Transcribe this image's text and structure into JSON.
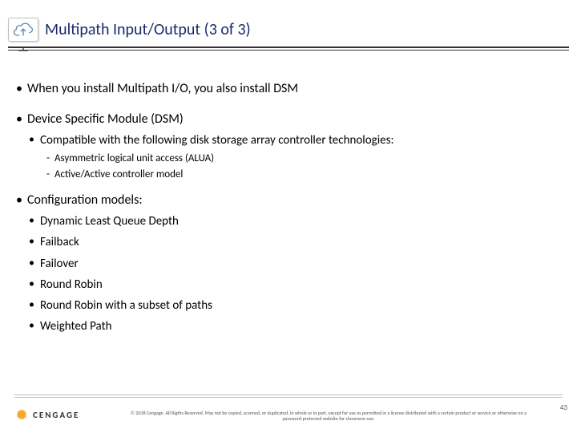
{
  "header": {
    "title": "Multipath Input/Output (3 of 3)",
    "icon": "cloud-icon"
  },
  "body": {
    "items": [
      {
        "level": 1,
        "text": "When you install Multipath I/O, you also install DSM"
      },
      {
        "level": 1,
        "text": "Device Specific Module (DSM)"
      },
      {
        "level": 2,
        "text": "Compatible with the following disk storage array controller technologies:"
      },
      {
        "level": 3,
        "text": "Asymmetric logical unit access (ALUA)"
      },
      {
        "level": 3,
        "text": "Active/Active controller model"
      },
      {
        "level": 1,
        "text": "Configuration models:"
      },
      {
        "level": 2,
        "text": "Dynamic Least Queue Depth"
      },
      {
        "level": 2,
        "text": "Failback"
      },
      {
        "level": 2,
        "text": "Failover"
      },
      {
        "level": 2,
        "text": "Round Robin"
      },
      {
        "level": 2,
        "text": "Round Robin with a subset of paths"
      },
      {
        "level": 2,
        "text": "Weighted Path"
      }
    ]
  },
  "footer": {
    "logo_text": "CENGAGE",
    "copyright": "© 2018 Cengage. All Rights Reserved. May not be copied, scanned, or duplicated, in whole or in part, except for use as permitted in a license distributed with a certain product or service or otherwise on a password-protected website for classroom use.",
    "page_number": "43"
  }
}
